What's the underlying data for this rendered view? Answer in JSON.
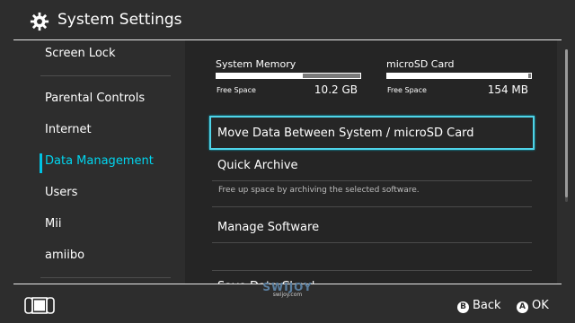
{
  "header": {
    "title": "System Settings",
    "icon": "gear-icon"
  },
  "sidebar": {
    "items": [
      {
        "label": "Screen Lock"
      },
      {
        "label": "Parental Controls"
      },
      {
        "label": "Internet"
      },
      {
        "label": "Data Management",
        "active": true
      },
      {
        "label": "Users"
      },
      {
        "label": "Mii"
      },
      {
        "label": "amiibo"
      }
    ]
  },
  "storage": {
    "system": {
      "label": "System Memory",
      "free_label": "Free Space",
      "free_value": "10.2 GB",
      "used_fraction": 0.6
    },
    "sd": {
      "label": "microSD Card",
      "free_label": "Free Space",
      "free_value": "154 MB",
      "used_fraction": 0.98
    }
  },
  "menu": {
    "move_data": "Move Data Between System / microSD Card",
    "quick_archive": "Quick Archive",
    "quick_archive_desc": "Free up space by archiving the selected software.",
    "manage_software": "Manage Software",
    "save_data_cloud": "Save Data Cloud"
  },
  "footer": {
    "back_button_glyph": "B",
    "back_label": "Back",
    "ok_button_glyph": "A",
    "ok_label": "OK"
  },
  "watermark": {
    "logo": "SWIJOY",
    "url": "swijoy.com"
  },
  "colors": {
    "accent": "#00c3e3",
    "background": "#2d2d2d",
    "content_bg": "#252525"
  }
}
